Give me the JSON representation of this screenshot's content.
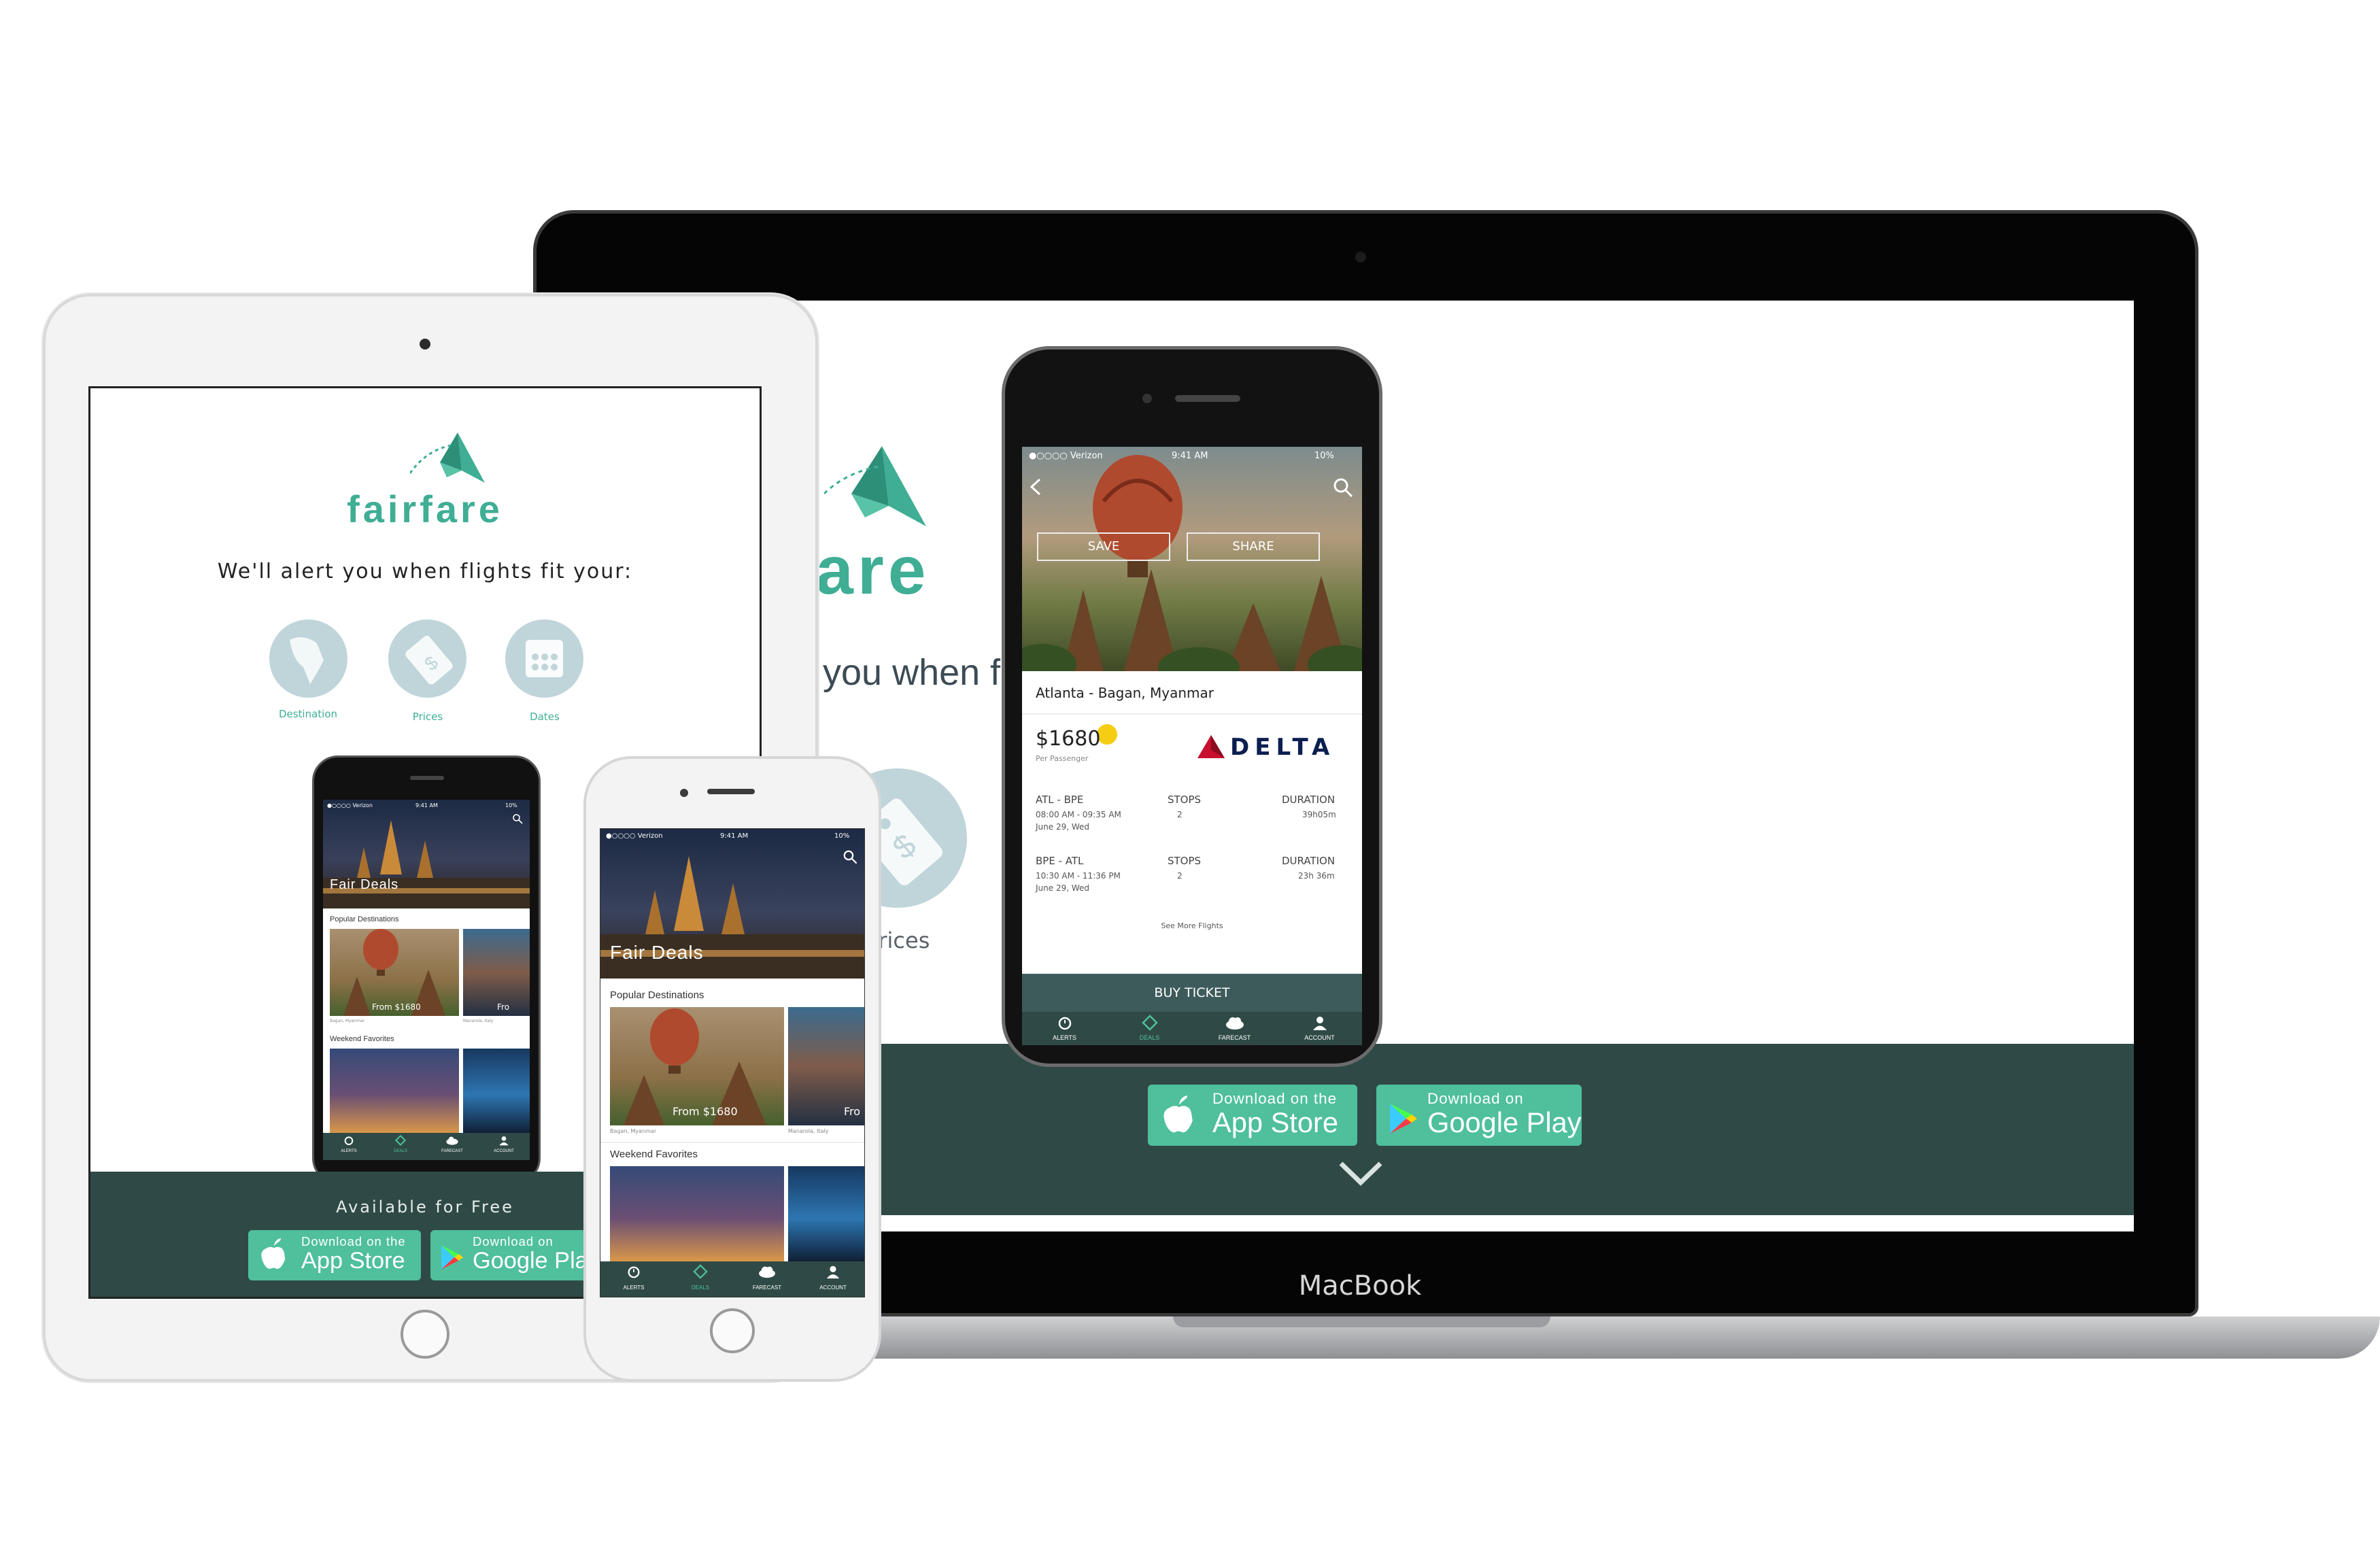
{
  "brand": {
    "name": "fairfare",
    "name_partial": "fare"
  },
  "website": {
    "tagline": "We'll alert you when flights fit your:",
    "tagline_partial": "t you when flights fit your:",
    "features": [
      {
        "label": "Destination",
        "icon": "globe-icon"
      },
      {
        "label": "Prices",
        "icon": "price-tag-icon"
      },
      {
        "label": "Dates",
        "icon": "calendar-icon"
      }
    ],
    "footer": {
      "available": "Available for Free"
    },
    "app_store": {
      "small": "Download on the",
      "big": "App Store"
    },
    "google_play": {
      "small": "Download on",
      "big": "Google Play"
    },
    "scroll_icon": "chevron-down-icon"
  },
  "device": {
    "laptop_label": "MacBook"
  },
  "status_bar": {
    "carrier": "Verizon",
    "time": "9:41 AM",
    "battery": "10%",
    "carrier_detail": "●○○○○ Verizon"
  },
  "detail_app": {
    "save": "SAVE",
    "share": "SHARE",
    "route": "Atlanta - Bagan, Myanmar",
    "price": "$1680",
    "per_passenger": "Per Passenger",
    "airline": "DELTA",
    "legs": [
      {
        "route": "ATL - BPE",
        "times": "08:00 AM - 09:35 AM",
        "date": "June 29, Wed",
        "stops_label": "STOPS",
        "stops": "2",
        "duration_label": "DURATION",
        "duration": "39h05m"
      },
      {
        "route": "BPE - ATL",
        "times": "10:30 AM - 11:36 PM",
        "date": "June 29, Wed",
        "stops_label": "STOPS",
        "stops": "2",
        "duration_label": "DURATION",
        "duration": "23h 36m"
      }
    ],
    "see_more": "See More Flights",
    "buy": "BUY TICKET"
  },
  "deals_app": {
    "title": "Fair Deals",
    "popular": "Popular Destinations",
    "popular_items": [
      {
        "price": "From $1680",
        "place": "Bagan, Myanmar"
      },
      {
        "price": "Fro",
        "place": "Manarola, Italy"
      }
    ],
    "weekend": "Weekend Favorites"
  },
  "tabs": [
    {
      "label": "ALERTS",
      "icon": "alarm-clock-icon"
    },
    {
      "label": "DEALS",
      "icon": "tag-icon"
    },
    {
      "label": "FARECAST",
      "icon": "cloud-icon"
    },
    {
      "label": "ACCOUNT",
      "icon": "user-icon"
    }
  ],
  "colors": {
    "brand_teal": "#3fae94",
    "footer_dark": "#2f4a46",
    "button_green": "#4fbf9c",
    "icon_circle": "#bfd5d9",
    "delta_red": "#c8102e",
    "delta_navy": "#0b1f4f"
  }
}
